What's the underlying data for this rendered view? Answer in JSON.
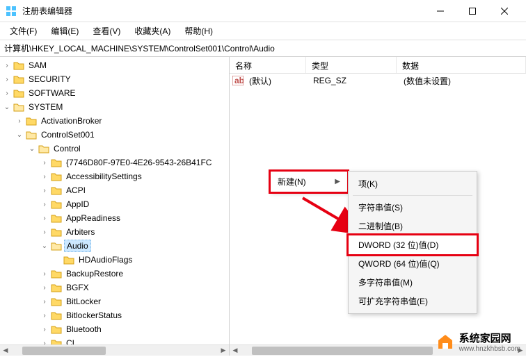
{
  "titlebar": {
    "title": "注册表编辑器"
  },
  "menubar": {
    "file": "文件(F)",
    "edit": "编辑(E)",
    "view": "查看(V)",
    "favorites": "收藏夹(A)",
    "help": "帮助(H)"
  },
  "addressbar": {
    "path": "计算机\\HKEY_LOCAL_MACHINE\\SYSTEM\\ControlSet001\\Control\\Audio"
  },
  "tree": {
    "items": [
      {
        "label": "SAM",
        "indent": 2,
        "expanded": false
      },
      {
        "label": "SECURITY",
        "indent": 2,
        "expanded": false
      },
      {
        "label": "SOFTWARE",
        "indent": 2,
        "expanded": false
      },
      {
        "label": "SYSTEM",
        "indent": 2,
        "expanded": true
      },
      {
        "label": "ActivationBroker",
        "indent": 3,
        "expanded": false
      },
      {
        "label": "ControlSet001",
        "indent": 3,
        "expanded": true
      },
      {
        "label": "Control",
        "indent": 4,
        "expanded": true
      },
      {
        "label": "{7746D80F-97E0-4E26-9543-26B41FC",
        "indent": 5,
        "expanded": false
      },
      {
        "label": "AccessibilitySettings",
        "indent": 5,
        "expanded": false
      },
      {
        "label": "ACPI",
        "indent": 5,
        "expanded": false
      },
      {
        "label": "AppID",
        "indent": 5,
        "expanded": false
      },
      {
        "label": "AppReadiness",
        "indent": 5,
        "expanded": false
      },
      {
        "label": "Arbiters",
        "indent": 5,
        "expanded": false
      },
      {
        "label": "Audio",
        "indent": 5,
        "expanded": true,
        "selected": true
      },
      {
        "label": "HDAudioFlags",
        "indent": 6,
        "expanded": null
      },
      {
        "label": "BackupRestore",
        "indent": 5,
        "expanded": false
      },
      {
        "label": "BGFX",
        "indent": 5,
        "expanded": false
      },
      {
        "label": "BitLocker",
        "indent": 5,
        "expanded": false
      },
      {
        "label": "BitlockerStatus",
        "indent": 5,
        "expanded": false
      },
      {
        "label": "Bluetooth",
        "indent": 5,
        "expanded": false
      },
      {
        "label": "CI",
        "indent": 5,
        "expanded": false
      }
    ]
  },
  "list": {
    "headers": {
      "name": "名称",
      "type": "类型",
      "data": "数据"
    },
    "rows": [
      {
        "name": "(默认)",
        "type": "REG_SZ",
        "data": "(数值未设置)"
      }
    ]
  },
  "context": {
    "new": "新建(N)",
    "submenu": {
      "key": "项(K)",
      "string": "字符串值(S)",
      "binary": "二进制值(B)",
      "dword": "DWORD (32 位)值(D)",
      "qword": "QWORD (64 位)值(Q)",
      "multistring": "多字符串值(M)",
      "expandstring": "可扩充字符串值(E)"
    }
  },
  "watermark": {
    "text": "系统家园网",
    "url": "www.hnzkhbsb.com"
  }
}
